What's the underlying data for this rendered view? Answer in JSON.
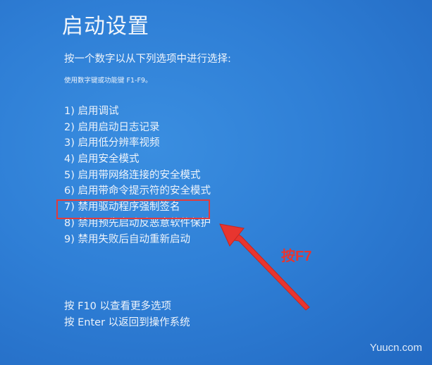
{
  "screen": {
    "title": "启动设置",
    "prompt": "按一个数字以从下列选项中进行选择:",
    "hint": "使用数字键或功能键 F1-F9。",
    "options": [
      "1) 启用调试",
      "2) 启用启动日志记录",
      "3) 启用低分辨率视频",
      "4) 启用安全模式",
      "5) 启用带网络连接的安全模式",
      "6) 启用带命令提示符的安全模式",
      "7) 禁用驱动程序强制签名",
      "8) 禁用预先启动反恶意软件保护",
      "9) 禁用失败后自动重新启动"
    ],
    "footer": [
      "按 F10 以查看更多选项",
      "按 Enter 以返回到操作系统"
    ]
  },
  "annotation": {
    "label": "按F7",
    "color": "#e8352f"
  },
  "watermark": "Yuucn.com",
  "colors": {
    "background": "#2f7fd6",
    "text": "#eef4fb",
    "highlight": "#e23b3b"
  }
}
